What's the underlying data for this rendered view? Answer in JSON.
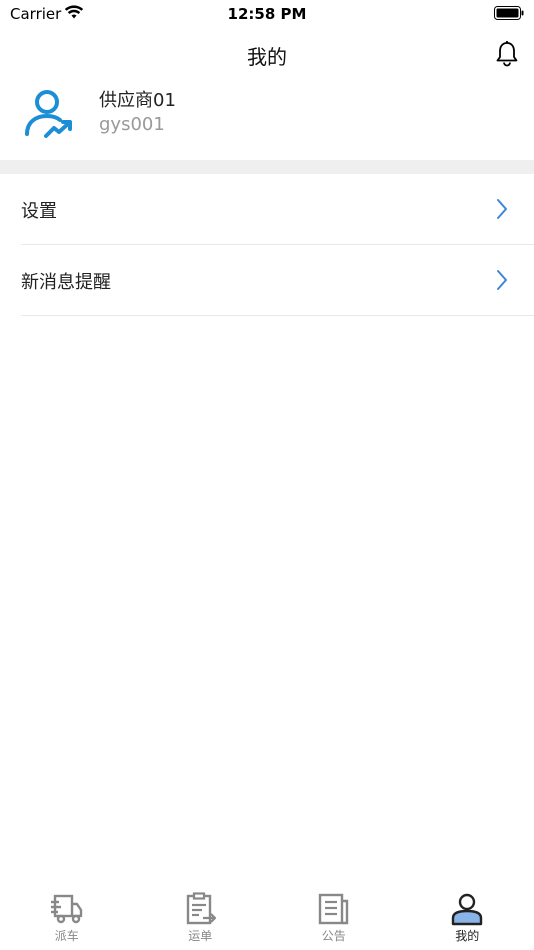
{
  "status_bar": {
    "carrier": "Carrier",
    "time": "12:58 PM"
  },
  "nav": {
    "title": "我的",
    "bell_icon": "bell-icon"
  },
  "profile": {
    "name": "供应商01",
    "id": "gys001",
    "avatar_icon": "user-trend-icon",
    "accent": "#1c8ed6"
  },
  "menu": [
    {
      "label": "设置"
    },
    {
      "label": "新消息提醒"
    }
  ],
  "tabs": [
    {
      "label": "派车",
      "icon": "truck-icon",
      "active": false
    },
    {
      "label": "运单",
      "icon": "waybill-icon",
      "active": false
    },
    {
      "label": "公告",
      "icon": "notice-icon",
      "active": false
    },
    {
      "label": "我的",
      "icon": "user-icon",
      "active": true
    }
  ],
  "colors": {
    "chevron": "#3b86d8",
    "tab_inactive": "#888888",
    "tab_active_fill": "#8ab4e8"
  }
}
